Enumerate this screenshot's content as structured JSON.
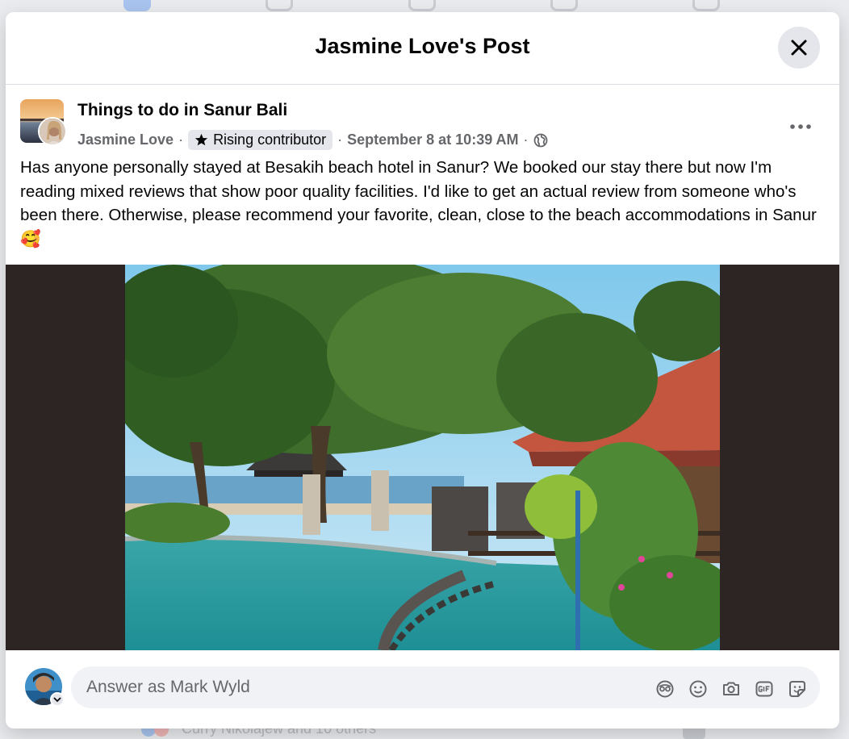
{
  "dialog": {
    "title": "Jasmine Love's Post"
  },
  "post": {
    "group_name": "Things to do in Sanur Bali",
    "author": "Jasmine Love",
    "badge": "Rising contributor",
    "date": "September 8 at 10:39 AM",
    "separator": "·",
    "text": "Has anyone personally stayed at Besakih beach hotel in Sanur? We booked our stay there but now I'm reading mixed reviews that show poor quality facilities. I'd like to get an actual review from someone who's been there. Otherwise, please recommend your favorite, clean, close to the beach accommodations in Sanur",
    "emoji": "🥰",
    "photo_icon": "resort-pool-photo"
  },
  "composer": {
    "placeholder": "Answer as Mark Wyld",
    "icons": [
      "avatar-sticker-icon",
      "emoji-icon",
      "camera-icon",
      "gif-icon",
      "sticker-icon"
    ]
  },
  "background": {
    "reactions_text": "Curry Nikolajew and 10 others"
  },
  "colors": {
    "modal_bg": "#ffffff",
    "photo_letterbox": "#2c2523",
    "badge_bg": "#e4e6eb",
    "input_bg": "#f0f2f5",
    "secondary_text": "#65676b"
  }
}
